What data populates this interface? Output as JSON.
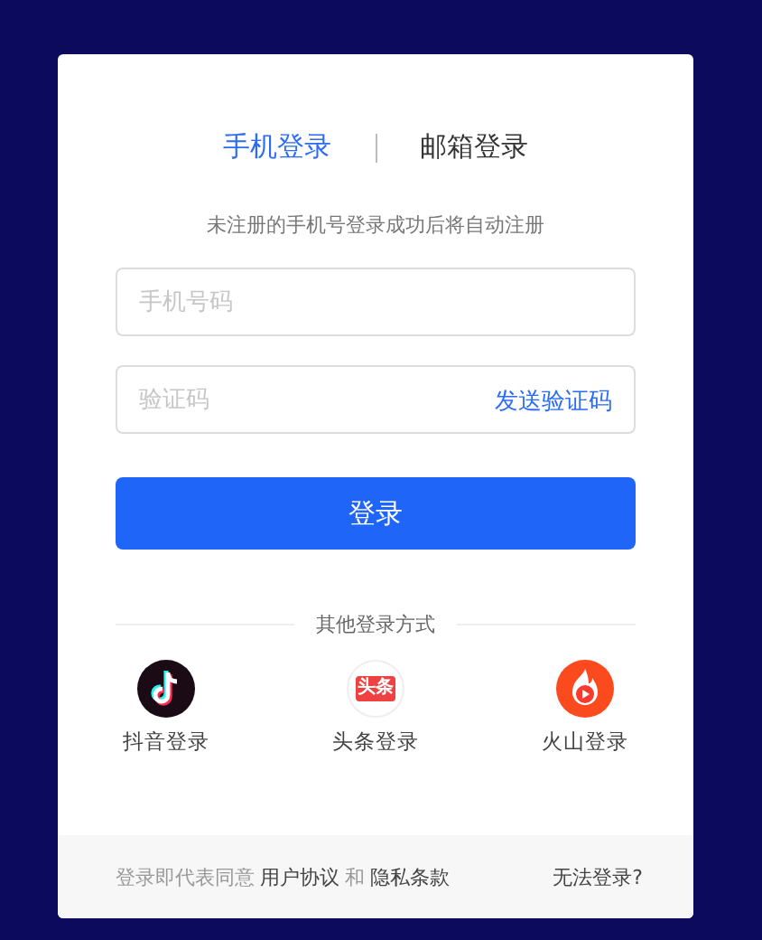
{
  "tabs": [
    {
      "label": "手机登录",
      "selected": true
    },
    {
      "label": "邮箱登录",
      "selected": false
    }
  ],
  "notice": "未注册的手机号登录成功后将自动注册",
  "phone_field": {
    "placeholder": "手机号码"
  },
  "code_field": {
    "placeholder": "验证码",
    "action": "发送验证码"
  },
  "login_button": "登录",
  "other_methods": {
    "title": "其他登录方式",
    "items": [
      {
        "kind": "douyin",
        "label": "抖音登录"
      },
      {
        "kind": "toutiao",
        "label": "头条登录",
        "icon_text": "头条"
      },
      {
        "kind": "huoshan",
        "label": "火山登录"
      }
    ]
  },
  "footer": {
    "agreement": [
      {
        "kind": "plain",
        "text": "登录即代表同意"
      },
      {
        "kind": "link",
        "text": "用户协议"
      },
      {
        "kind": "plain",
        "text": "和"
      },
      {
        "kind": "link",
        "text": "隐私条款"
      }
    ],
    "help_link": "无法登录?"
  }
}
